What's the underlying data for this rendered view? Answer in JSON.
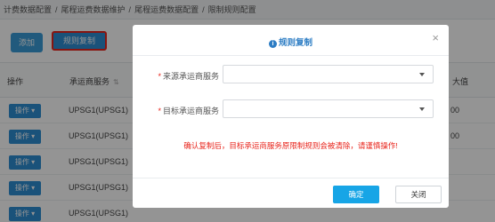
{
  "breadcrumb": [
    "计费数据配置",
    "/",
    "尾程运费数据维护",
    "/",
    "尾程运费数据配置",
    "/",
    "限制规则配置"
  ],
  "toolbar": {
    "add_label": "添加",
    "copy_rule_label": "规则复制"
  },
  "table": {
    "headers": {
      "operation": "操作",
      "carrier_service": "承运商服务",
      "max": "大值"
    },
    "rows": [
      {
        "op_label": "操作",
        "carrier_service": "UPSG1(UPSG1)",
        "max": "00"
      },
      {
        "op_label": "操作",
        "carrier_service": "UPSG1(UPSG1)",
        "max": "00"
      },
      {
        "op_label": "操作",
        "carrier_service": "UPSG1(UPSG1)",
        "max": ""
      },
      {
        "op_label": "操作",
        "carrier_service": "UPSG1(UPSG1)",
        "max": ""
      },
      {
        "op_label": "操作",
        "carrier_service": "UPSG1(UPSG1)",
        "max": ""
      }
    ]
  },
  "modal": {
    "title": "规则复制",
    "source_label": "来源承运商服务",
    "target_label": "目标承运商服务",
    "source_value": "",
    "target_value": "",
    "warning": "确认复制后，目标承运商服务原限制规则会被清除，请谨慎操作!",
    "confirm_label": "确定",
    "close_label": "关闭"
  },
  "colors": {
    "primary": "#2e8ed3",
    "highlight_border": "#e8251c",
    "warning_text": "#e8251c",
    "confirm": "#17a5e6"
  }
}
